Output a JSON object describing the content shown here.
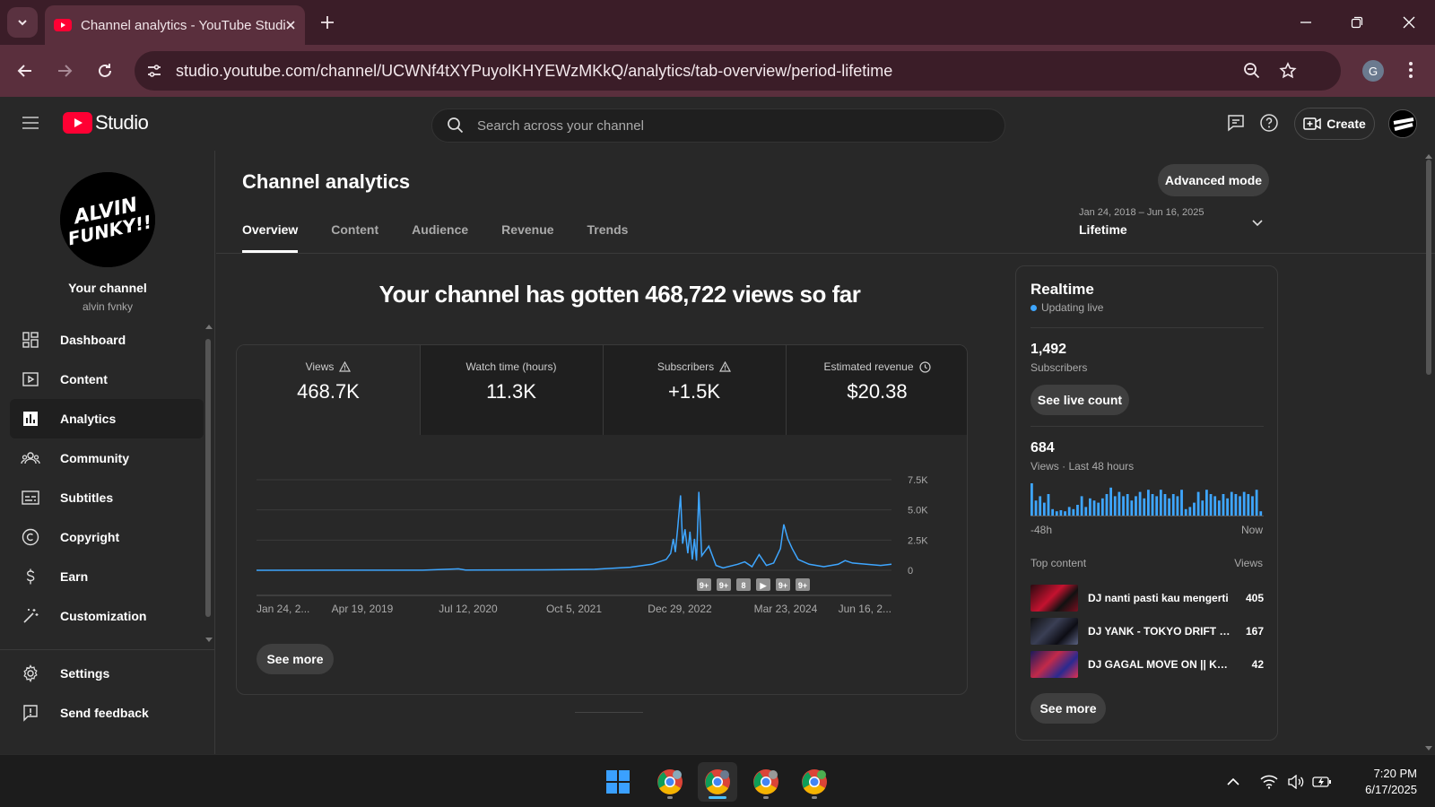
{
  "browser": {
    "tab_title": "Channel analytics - YouTube Studio",
    "url": "studio.youtube.com/channel/UCWNf4tXYPuyolKHYEWzMKkQ/analytics/tab-overview/period-lifetime"
  },
  "header": {
    "logo_text": "Studio",
    "search_placeholder": "Search across your channel",
    "create_label": "Create"
  },
  "sidebar": {
    "channel_label": "Your channel",
    "channel_handle": "alvin fvnky",
    "items": [
      {
        "label": "Dashboard",
        "icon": "dashboard-icon"
      },
      {
        "label": "Content",
        "icon": "content-icon"
      },
      {
        "label": "Analytics",
        "icon": "analytics-icon",
        "active": true
      },
      {
        "label": "Community",
        "icon": "community-icon"
      },
      {
        "label": "Subtitles",
        "icon": "subtitles-icon"
      },
      {
        "label": "Copyright",
        "icon": "copyright-icon"
      },
      {
        "label": "Earn",
        "icon": "earn-icon"
      },
      {
        "label": "Customization",
        "icon": "customization-icon"
      }
    ],
    "settings_label": "Settings",
    "feedback_label": "Send feedback"
  },
  "main": {
    "title": "Channel analytics",
    "advanced_mode_label": "Advanced mode",
    "tabs": [
      "Overview",
      "Content",
      "Audience",
      "Revenue",
      "Trends"
    ],
    "active_tab": "Overview",
    "date_range": "Jan 24, 2018 – Jun 16, 2025",
    "period": "Lifetime",
    "headline": "Your channel has gotten 468,722 views so far",
    "metrics": [
      {
        "label": "Views",
        "value": "468.7K",
        "icon": "warning-icon"
      },
      {
        "label": "Watch time (hours)",
        "value": "11.3K",
        "icon": ""
      },
      {
        "label": "Subscribers",
        "value": "+1.5K",
        "icon": "warning-icon"
      },
      {
        "label": "Estimated revenue",
        "value": "$20.38",
        "icon": "clock-icon"
      }
    ],
    "see_more_label": "See more",
    "markers": [
      "9+",
      "9+",
      "8",
      "▶",
      "9+",
      "9+"
    ]
  },
  "chart_data": {
    "type": "line",
    "x_tick_labels": [
      "Jan 24, 2...",
      "Apr 19, 2019",
      "Jul 12, 2020",
      "Oct 5, 2021",
      "Dec 29, 2022",
      "Mar 23, 2024",
      "Jun 16, 2..."
    ],
    "y_tick_labels": [
      "7.5K",
      "5.0K",
      "2.5K",
      "0"
    ],
    "ylim": [
      0,
      7500
    ],
    "grid": true,
    "series": [
      {
        "color": "#3ea6ff",
        "points": [
          [
            "2018-01-24",
            0
          ],
          [
            "2019-01-01",
            5
          ],
          [
            "2020-01-01",
            10
          ],
          [
            "2020-06-01",
            120
          ],
          [
            "2020-07-01",
            20
          ],
          [
            "2021-06-01",
            40
          ],
          [
            "2022-01-01",
            80
          ],
          [
            "2022-06-01",
            250
          ],
          [
            "2022-09-01",
            500
          ],
          [
            "2022-11-01",
            900
          ],
          [
            "2022-11-20",
            1400
          ],
          [
            "2022-12-01",
            2600
          ],
          [
            "2022-12-10",
            1500
          ],
          [
            "2022-12-20",
            3500
          ],
          [
            "2023-01-01",
            6200
          ],
          [
            "2023-01-10",
            2200
          ],
          [
            "2023-01-20",
            3400
          ],
          [
            "2023-02-01",
            1400
          ],
          [
            "2023-02-10",
            3200
          ],
          [
            "2023-02-20",
            900
          ],
          [
            "2023-03-01",
            2600
          ],
          [
            "2023-03-10",
            800
          ],
          [
            "2023-03-20",
            6500
          ],
          [
            "2023-04-01",
            1200
          ],
          [
            "2023-05-01",
            2000
          ],
          [
            "2023-06-01",
            400
          ],
          [
            "2023-07-01",
            200
          ],
          [
            "2023-09-01",
            500
          ],
          [
            "2023-10-01",
            700
          ],
          [
            "2023-11-01",
            300
          ],
          [
            "2023-12-01",
            1300
          ],
          [
            "2024-01-01",
            400
          ],
          [
            "2024-02-01",
            600
          ],
          [
            "2024-03-01",
            1800
          ],
          [
            "2024-03-15",
            3800
          ],
          [
            "2024-04-01",
            2600
          ],
          [
            "2024-04-20",
            1800
          ],
          [
            "2024-05-15",
            900
          ],
          [
            "2024-07-01",
            500
          ],
          [
            "2024-09-01",
            300
          ],
          [
            "2024-11-01",
            500
          ],
          [
            "2024-12-01",
            800
          ],
          [
            "2025-01-01",
            600
          ],
          [
            "2025-03-01",
            500
          ],
          [
            "2025-05-01",
            400
          ],
          [
            "2025-06-16",
            500
          ]
        ]
      }
    ]
  },
  "realtime": {
    "title": "Realtime",
    "status": "Updating live",
    "subscribers_value": "1,492",
    "subscribers_label": "Subscribers",
    "live_count_label": "See live count",
    "views_value": "684",
    "views_label": "Views · Last 48 hours",
    "axis_start": "-48h",
    "axis_end": "Now",
    "bars": [
      30,
      14,
      18,
      12,
      20,
      6,
      4,
      5,
      4,
      8,
      6,
      10,
      18,
      8,
      16,
      14,
      12,
      16,
      20,
      26,
      18,
      22,
      18,
      20,
      14,
      18,
      22,
      16,
      24,
      20,
      18,
      24,
      20,
      16,
      20,
      18,
      24,
      6,
      8,
      12,
      22,
      14,
      24,
      20,
      18,
      14,
      20,
      16,
      22,
      20,
      18,
      22,
      20,
      18,
      24,
      4
    ],
    "top_content_label": "Top content",
    "views_col_label": "Views",
    "top_content": [
      {
        "title": "DJ nanti pasti kau mengerti",
        "views": "405"
      },
      {
        "title": "DJ YANK - TOKYO DRIFT DJ",
        "views": "167"
      },
      {
        "title": "DJ GAGAL MOVE ON || KANGEN",
        "views": "42"
      }
    ],
    "see_more_label": "See more"
  },
  "taskbar": {
    "time": "7:20 PM",
    "date": "6/17/2025"
  }
}
